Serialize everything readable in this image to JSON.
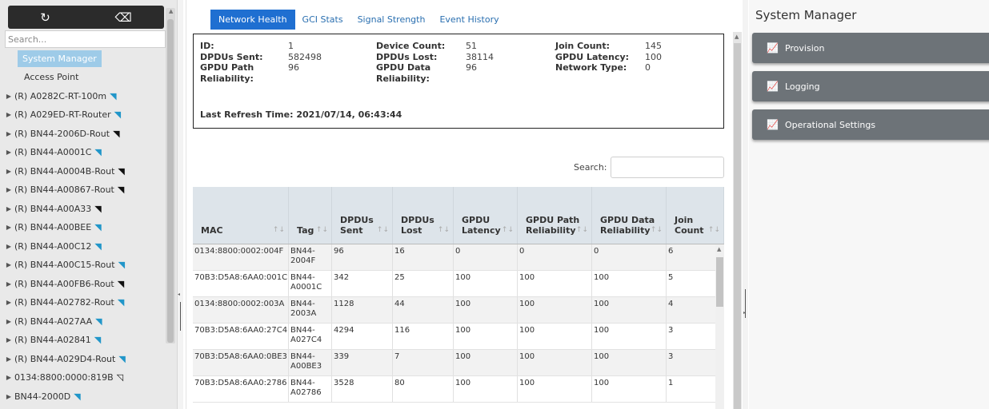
{
  "sidebar": {
    "refresh_icon": "↻",
    "clear_icon": "⌫",
    "search_placeholder": "Search...",
    "items": [
      {
        "label": "System Manager",
        "selected": true,
        "expandable": false,
        "icon": ""
      },
      {
        "label": "Access Point",
        "selected": false,
        "expandable": false,
        "icon": ""
      },
      {
        "label": "(R) A0282C-RT-100m",
        "expandable": true,
        "icon": "wifi-blue"
      },
      {
        "label": "(R) A029ED-RT-Router",
        "expandable": true,
        "icon": "wifi-blue"
      },
      {
        "label": "(R) BN44-2006D-Rout",
        "expandable": true,
        "icon": "wifi-black"
      },
      {
        "label": "(R) BN44-A0001C",
        "expandable": true,
        "icon": "wifi-blue"
      },
      {
        "label": "(R) BN44-A0004B-Rout",
        "expandable": true,
        "icon": "wifi-black"
      },
      {
        "label": "(R) BN44-A00867-Rout",
        "expandable": true,
        "icon": "wifi-black"
      },
      {
        "label": "(R) BN44-A00A33",
        "expandable": true,
        "icon": "wifi-black"
      },
      {
        "label": "(R) BN44-A00BEE",
        "expandable": true,
        "icon": "wifi-blue"
      },
      {
        "label": "(R) BN44-A00C12",
        "expandable": true,
        "icon": "wifi-blue"
      },
      {
        "label": "(R) BN44-A00C15-Rout",
        "expandable": true,
        "icon": "wifi-blue"
      },
      {
        "label": "(R) BN44-A00FB6-Rout",
        "expandable": true,
        "icon": "wifi-black"
      },
      {
        "label": "(R) BN44-A02782-Rout",
        "expandable": true,
        "icon": "wifi-blue"
      },
      {
        "label": "(R) BN44-A027AA",
        "expandable": true,
        "icon": "wifi-blue"
      },
      {
        "label": "(R) BN44-A02841",
        "expandable": true,
        "icon": "wifi-blue"
      },
      {
        "label": "(R) BN44-A029D4-Rout",
        "expandable": true,
        "icon": "wifi-blue"
      },
      {
        "label": "0134:8800:0000:819B",
        "expandable": true,
        "icon": "wifi-outline"
      },
      {
        "label": "BN44-2000D",
        "expandable": true,
        "icon": "wifi-blue"
      }
    ]
  },
  "tabs": [
    {
      "label": "Network Health",
      "active": true
    },
    {
      "label": "GCI Stats",
      "active": false
    },
    {
      "label": "Signal Strength",
      "active": false
    },
    {
      "label": "Event History",
      "active": false
    }
  ],
  "summary": {
    "rows": [
      [
        [
          "ID:",
          "1"
        ],
        [
          "Device Count:",
          "51"
        ],
        [
          "Join Count:",
          "145"
        ]
      ],
      [
        [
          "DPDUs Sent:",
          "582498"
        ],
        [
          "DPDUs Lost:",
          "38114"
        ],
        [
          "GPDU Latency:",
          "100"
        ]
      ],
      [
        [
          "GPDU Path Reliability:",
          "96"
        ],
        [
          "GPDU Data Reliability:",
          "96"
        ],
        [
          "Network Type:",
          "0"
        ]
      ]
    ],
    "last_refresh_label": "Last Refresh Time:",
    "last_refresh_value": "2021/07/14, 06:43:44"
  },
  "table": {
    "search_label": "Search:",
    "columns": [
      "MAC",
      "Tag",
      "DPDUs Sent",
      "DPDUs Lost",
      "GPDU Latency",
      "GPDU Path Reliability",
      "GPDU Data Reliability",
      "Join Count"
    ],
    "rows": [
      [
        "0134:8800:0002:004F",
        "BN44-2004F",
        "96",
        "16",
        "0",
        "0",
        "0",
        "6"
      ],
      [
        "70B3:D5A8:6AA0:001C",
        "BN44-A0001C",
        "342",
        "25",
        "100",
        "100",
        "100",
        "5"
      ],
      [
        "0134:8800:0002:003A",
        "BN44-2003A",
        "1128",
        "44",
        "100",
        "100",
        "100",
        "4"
      ],
      [
        "70B3:D5A8:6AA0:27C4",
        "BN44-A027C4",
        "4294",
        "116",
        "100",
        "100",
        "100",
        "3"
      ],
      [
        "70B3:D5A8:6AA0:0BE3",
        "BN44-A00BE3",
        "339",
        "7",
        "100",
        "100",
        "100",
        "3"
      ],
      [
        "70B3:D5A8:6AA0:2786",
        "BN44-A02786",
        "3528",
        "80",
        "100",
        "100",
        "100",
        "1"
      ]
    ]
  },
  "right_panel": {
    "title": "System Manager",
    "items": [
      "Provision",
      "Logging",
      "Operational Settings"
    ],
    "item_icon": "📈"
  }
}
